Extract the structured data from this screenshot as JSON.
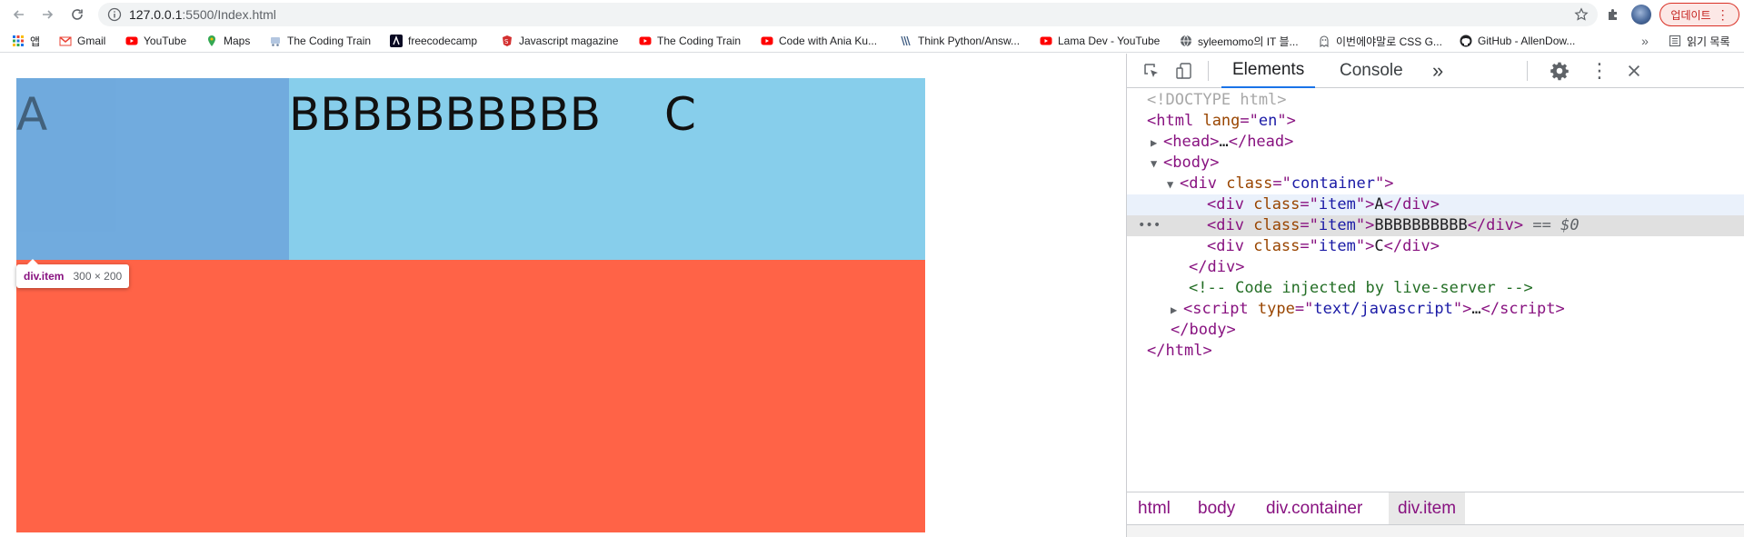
{
  "browser": {
    "url_host": "127.0.0.1",
    "url_path": ":5500/Index.html",
    "update_label": "업데이트"
  },
  "bookmarks": [
    {
      "icon": "apps-grid-icon",
      "label": "앱"
    },
    {
      "icon": "gmail-icon",
      "label": "Gmail"
    },
    {
      "icon": "youtube-icon",
      "label": "YouTube"
    },
    {
      "icon": "maps-pin-icon",
      "label": "Maps"
    },
    {
      "icon": "coding-train-icon",
      "label": "The Coding Train"
    },
    {
      "icon": "freecodecamp-icon",
      "label": "freecodecamp"
    },
    {
      "icon": "js-magazine-icon",
      "label": "Javascript magazine"
    },
    {
      "icon": "coding-train-icon",
      "label": "The Coding Train"
    },
    {
      "icon": "youtube-icon",
      "label": "Code with Ania Ku..."
    },
    {
      "icon": "think-python-icon",
      "label": "Think Python/Answ..."
    },
    {
      "icon": "youtube-icon",
      "label": "Lama Dev - YouTube"
    },
    {
      "icon": "globe-icon",
      "label": "syleemomo의 IT 블..."
    },
    {
      "icon": "css-ghost-icon",
      "label": "이번에야말로 CSS G..."
    },
    {
      "icon": "github-icon",
      "label": "GitHub - AllenDow..."
    },
    {
      "icon": "reading-list-icon",
      "label": "읽기 목록"
    }
  ],
  "page": {
    "item_a": "A",
    "item_b": "BBBBBBBBBB",
    "item_c": "C",
    "tooltip_tag": "div.item",
    "tooltip_dims": "300 × 200",
    "colors": {
      "container": "#87ceeb",
      "item_highlight": "#6fa8dc",
      "red_block": "#ff6347"
    }
  },
  "devtools": {
    "tabs": [
      "Elements",
      "Console"
    ],
    "dom": {
      "doctype": "<!DOCTYPE html>",
      "html_open": "html",
      "lang_attr": "lang",
      "lang_val": "en",
      "head": "head",
      "ellipsis": "…",
      "body": "body",
      "div": "div",
      "class_attr": "class",
      "container_val": "container",
      "item_val": "item",
      "text_a": "A",
      "text_b": "BBBBBBBBBB",
      "text_c": "C",
      "selected_marker": "== $0",
      "comment": "<!-- Code injected by live-server -->",
      "script": "script",
      "type_attr": "type",
      "type_val": "text/javascript"
    },
    "breadcrumbs": [
      "html",
      "body",
      "div.container",
      "div.item"
    ]
  }
}
